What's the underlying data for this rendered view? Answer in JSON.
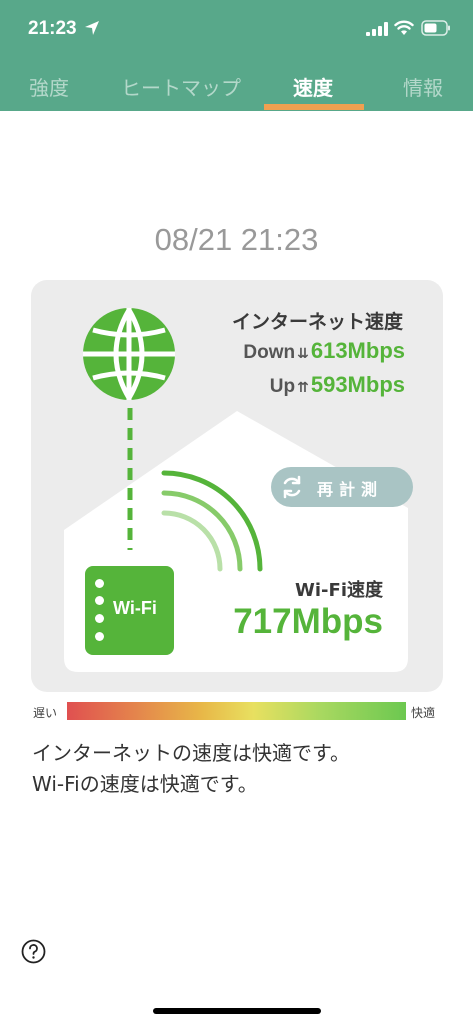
{
  "status_bar": {
    "time": "21:23",
    "icons": [
      "location-arrow-icon",
      "cellular-signal-icon",
      "wifi-icon",
      "battery-icon"
    ]
  },
  "tabs": [
    {
      "label": "強度",
      "active": false
    },
    {
      "label": "ヒートマップ",
      "active": false
    },
    {
      "label": "速度",
      "active": true
    },
    {
      "label": "情報",
      "active": false
    }
  ],
  "measurement": {
    "datetime": "08/21 21:23"
  },
  "internet": {
    "label": "インターネット速度",
    "down_label": "Down",
    "down_value": "613Mbps",
    "up_label": "Up",
    "up_value": "593Mbps"
  },
  "remeasure": {
    "label": "再計測"
  },
  "router": {
    "label": "Wi-Fi"
  },
  "wifi": {
    "label": "Wi-Fi速度",
    "value": "717Mbps"
  },
  "scale": {
    "slow_label": "遅い",
    "fast_label": "快適"
  },
  "message": {
    "line1": "インターネットの速度は快適です。",
    "line2": "Wi-Fiの速度は快適です。"
  },
  "colors": {
    "header": "#58a88a",
    "accent_green": "#55b43a",
    "tab_indicator": "#f0a050",
    "remeasure_button": "#a9c4c4"
  }
}
